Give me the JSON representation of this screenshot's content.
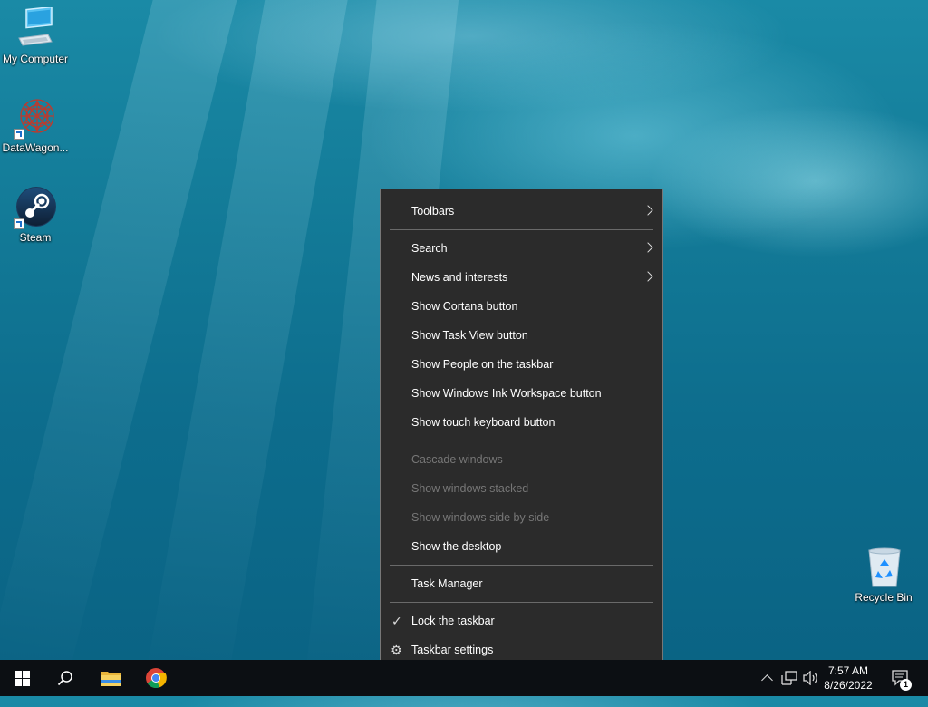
{
  "desktop": {
    "icons": [
      {
        "label": "My Computer",
        "icon": "computer-icon"
      },
      {
        "label": "DataWagon...",
        "icon": "datawagon-icon"
      },
      {
        "label": "Steam",
        "icon": "steam-icon"
      },
      {
        "label": "Recycle Bin",
        "icon": "recycle-bin-icon"
      }
    ]
  },
  "context_menu": {
    "toolbars": "Toolbars",
    "search": "Search",
    "news": "News and interests",
    "cortana": "Show Cortana button",
    "taskview": "Show Task View button",
    "people": "Show People on the taskbar",
    "ink": "Show Windows Ink Workspace button",
    "touch_keyboard": "Show touch keyboard button",
    "cascade": "Cascade windows",
    "stacked": "Show windows stacked",
    "side_by_side": "Show windows side by side",
    "show_desktop": "Show the desktop",
    "task_manager": "Task Manager",
    "lock": "Lock the taskbar",
    "lock_checked": true,
    "settings": "Taskbar settings"
  },
  "taskbar": {
    "time": "7:57 AM",
    "date": "8/26/2022",
    "notification_count": "1",
    "apps": [
      "start-icon",
      "search-icon",
      "file-explorer-icon",
      "chrome-icon"
    ],
    "tray": [
      "chevron-up-icon",
      "network-icon",
      "volume-icon",
      "action-center-icon"
    ]
  }
}
